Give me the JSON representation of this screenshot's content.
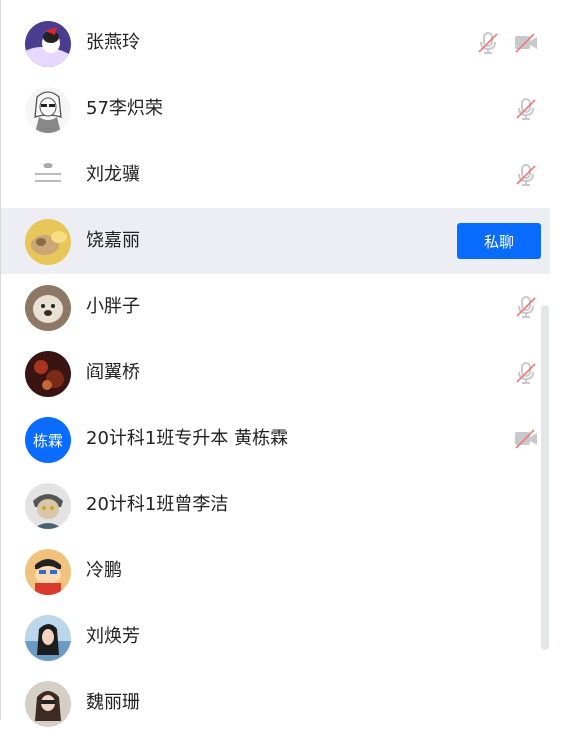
{
  "members": [
    {
      "name": "张燕玲",
      "avatar_icon": "avatar-photo-penguin",
      "mic": "muted",
      "cam": "off"
    },
    {
      "name": "57李炽荣",
      "avatar_icon": "avatar-photo-sketch-girl",
      "mic": "muted"
    },
    {
      "name": "刘龙骥",
      "avatar_icon": "avatar-photo-text-card",
      "mic": "muted"
    },
    {
      "name": "饶嘉丽",
      "avatar_icon": "avatar-photo-dog-yellow",
      "hovered": true,
      "action": "私聊"
    },
    {
      "name": "小胖子",
      "avatar_icon": "avatar-photo-plush-dog",
      "mic": "muted"
    },
    {
      "name": "阎翼桥",
      "avatar_icon": "avatar-photo-dark-red",
      "mic": "muted"
    },
    {
      "name": "20计科1班专升本 黄栋霖",
      "avatar_text": "栋霖",
      "cam": "off"
    },
    {
      "name": "20计科1班曾李洁",
      "avatar_icon": "avatar-photo-anime-boy"
    },
    {
      "name": "冷鹏",
      "avatar_icon": "avatar-photo-cartoon-boy"
    },
    {
      "name": "刘焕芳",
      "avatar_icon": "avatar-photo-girl-sea"
    },
    {
      "name": "魏丽珊",
      "avatar_icon": "avatar-photo-girl-brown"
    }
  ],
  "colors": {
    "accent": "#0a6cff",
    "hover_bg": "#eceef3",
    "muted_slash": "#f07a7a",
    "icon_gray": "#c8c9cc"
  }
}
